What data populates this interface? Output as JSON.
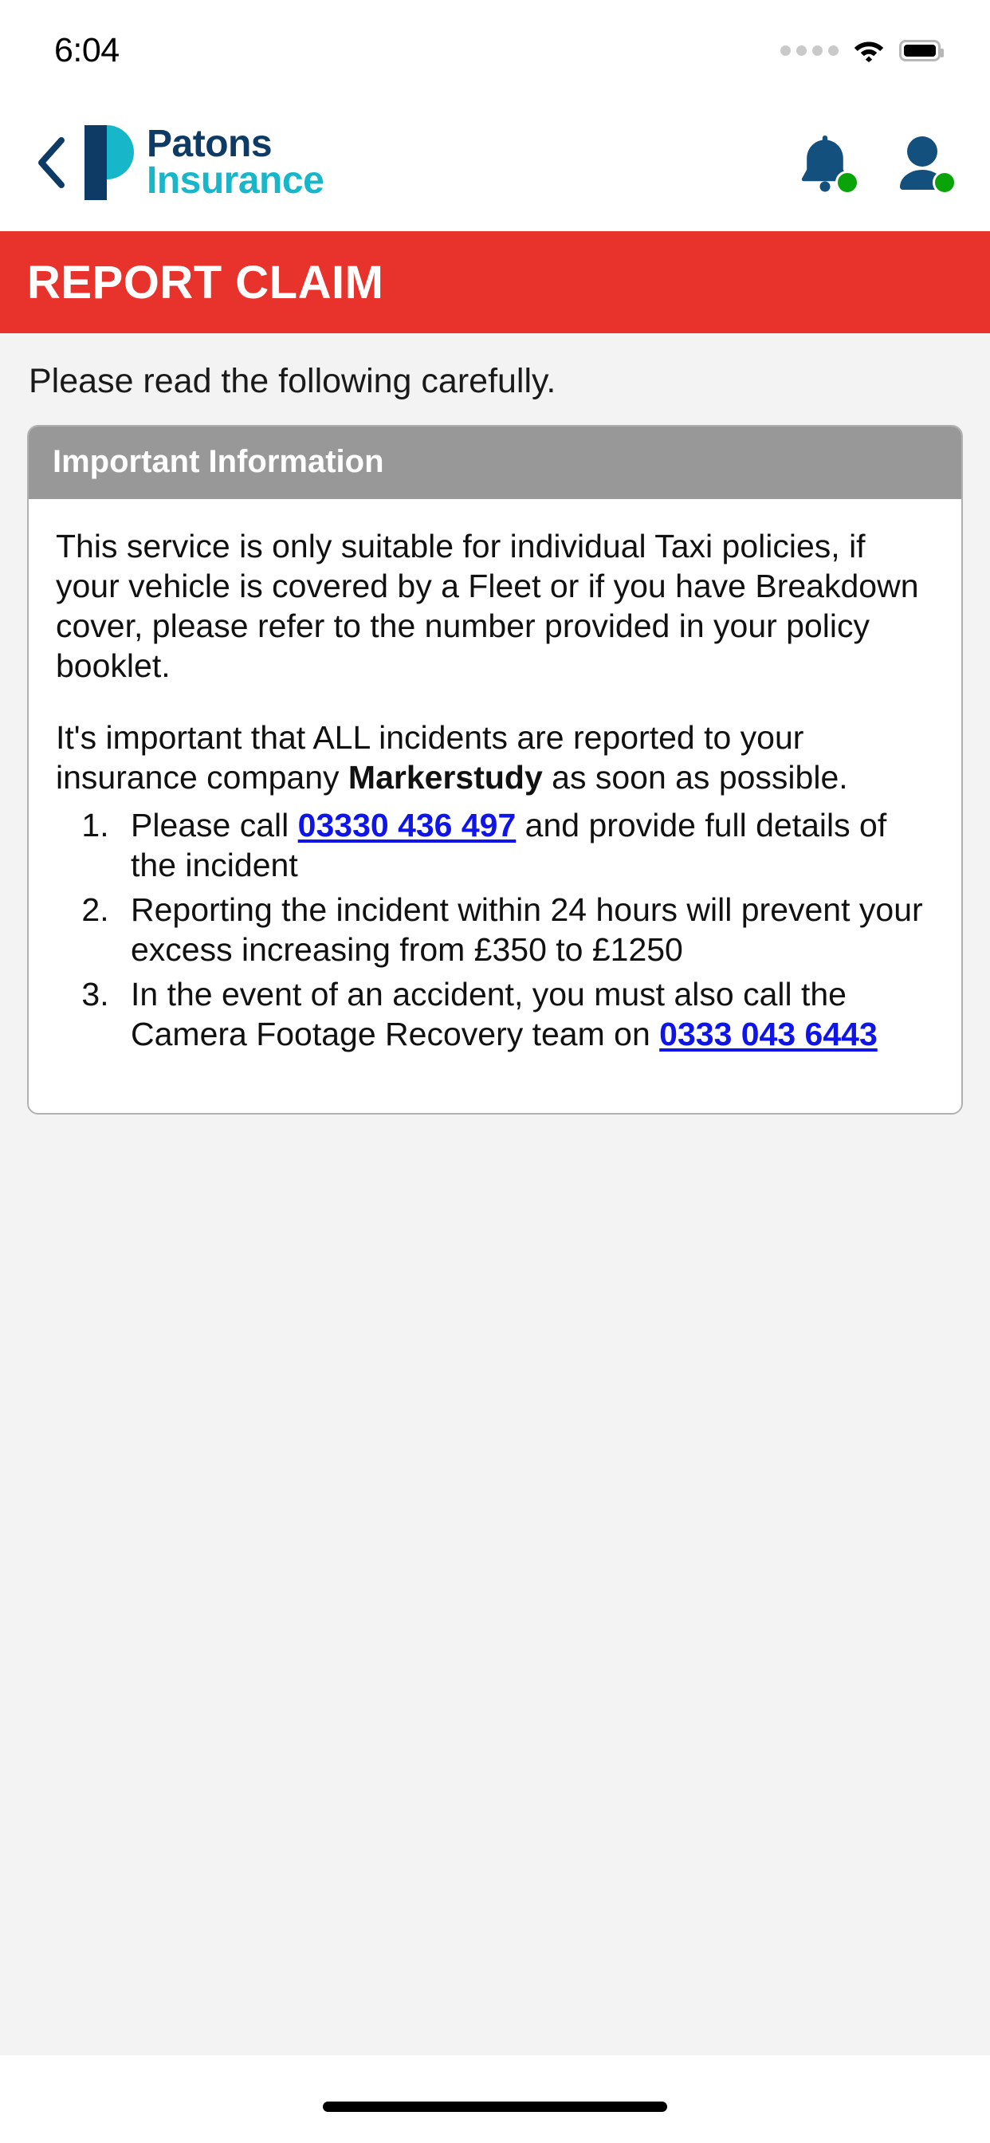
{
  "status_bar": {
    "time": "6:04",
    "signal_icon": "signal-dots-icon",
    "wifi_icon": "wifi-icon",
    "battery_icon": "battery-full-icon"
  },
  "app_bar": {
    "back_icon": "chevron-left-icon",
    "logo": {
      "mark_icon": "patons-p-logo-icon",
      "line1": "Patons",
      "line2": "Insurance",
      "navy": "#0d3b66",
      "teal": "#18b6c9"
    },
    "notifications": {
      "icon": "bell-icon",
      "badge_color": "#0aa30a"
    },
    "account": {
      "icon": "user-account-icon",
      "badge_color": "#0aa30a"
    }
  },
  "banner": {
    "title": "REPORT CLAIM",
    "background": "#e8332c",
    "text_color": "#ffffff"
  },
  "page": {
    "subtitle": "Please read the following carefully.",
    "background": "#f3f3f3"
  },
  "card": {
    "header_title": "Important Information",
    "header_background": "#989898",
    "border_color": "#b0b0b0",
    "paragraph_1": "This service is only suitable for individual Taxi policies, if your vehicle is covered by a Fleet or if you have Breakdown cover, please refer to the number provided in your policy booklet.",
    "paragraph_2_part1": "It's important that ALL incidents are reported to your insurance company ",
    "paragraph_2_bold": "Markerstudy",
    "paragraph_2_part2": " as soon as possible.",
    "steps": [
      {
        "text_before": "Please call ",
        "link": "03330 436 497",
        "text_after": " and provide full details of the incident"
      },
      {
        "text_before": "Reporting the incident within 24 hours will prevent your excess increasing from £350 to £1250",
        "link": "",
        "text_after": ""
      },
      {
        "text_before": "In the event of an accident, you must also call the Camera Footage Recovery team on ",
        "link": "0333 043 6443",
        "text_after": ""
      }
    ],
    "link_color": "#0f15e8"
  },
  "bottom": {
    "home_indicator": "home-indicator"
  }
}
